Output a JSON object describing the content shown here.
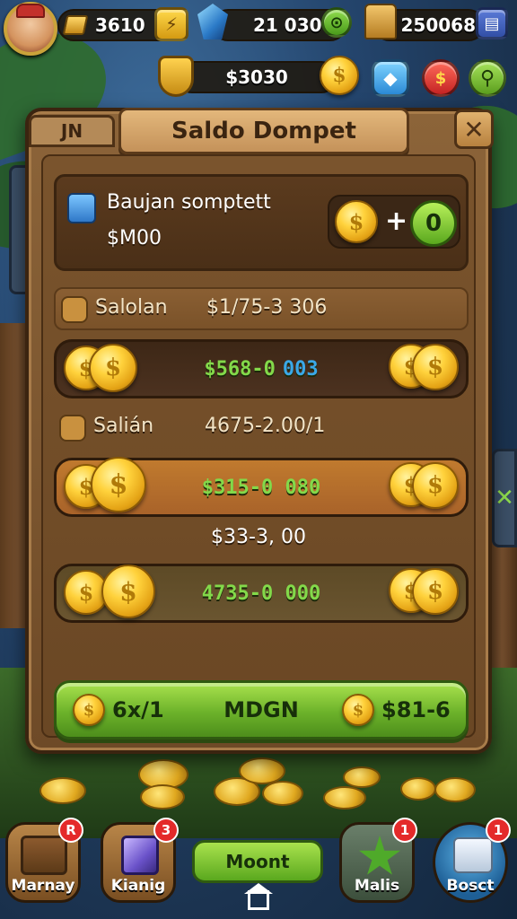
{
  "hud": {
    "gold_value": "3610",
    "gem_value": "21 030",
    "ticket_value": "250068",
    "cash_value": "$3030"
  },
  "panel": {
    "title": "Saldo Dompet",
    "tab_stub": "JN",
    "close": "✕",
    "wallet": {
      "label": "Baujan somptett",
      "amount": "$M00",
      "add_plus": "+",
      "add_value": "0"
    },
    "row1": {
      "label": "Salolan",
      "value": "$1/75-3 306"
    },
    "bar1": {
      "value_a": "$568-0",
      "value_b": "003"
    },
    "row2": {
      "label": "Salián",
      "value": "4675-2.00/1"
    },
    "bar2": {
      "value": "$315-0 080"
    },
    "total": "$33-3, 00",
    "bar3": {
      "value": "4735-0 000"
    },
    "green_button": {
      "left": "6x/1",
      "center": "MDGN",
      "right": "$81-6"
    }
  },
  "dock": {
    "items": [
      {
        "label": "Marnay",
        "badge": "R"
      },
      {
        "label": "Kianig",
        "badge": "3"
      },
      {
        "label": "Moont",
        "badge": ""
      },
      {
        "label": "Malis",
        "badge": "1"
      },
      {
        "label": "Bosct",
        "badge": "1"
      }
    ]
  },
  "colors": {
    "accent_green": "#6cb22a",
    "value_green": "#83d94a",
    "value_blue": "#3aa8e8",
    "wood": "#7a542d"
  }
}
